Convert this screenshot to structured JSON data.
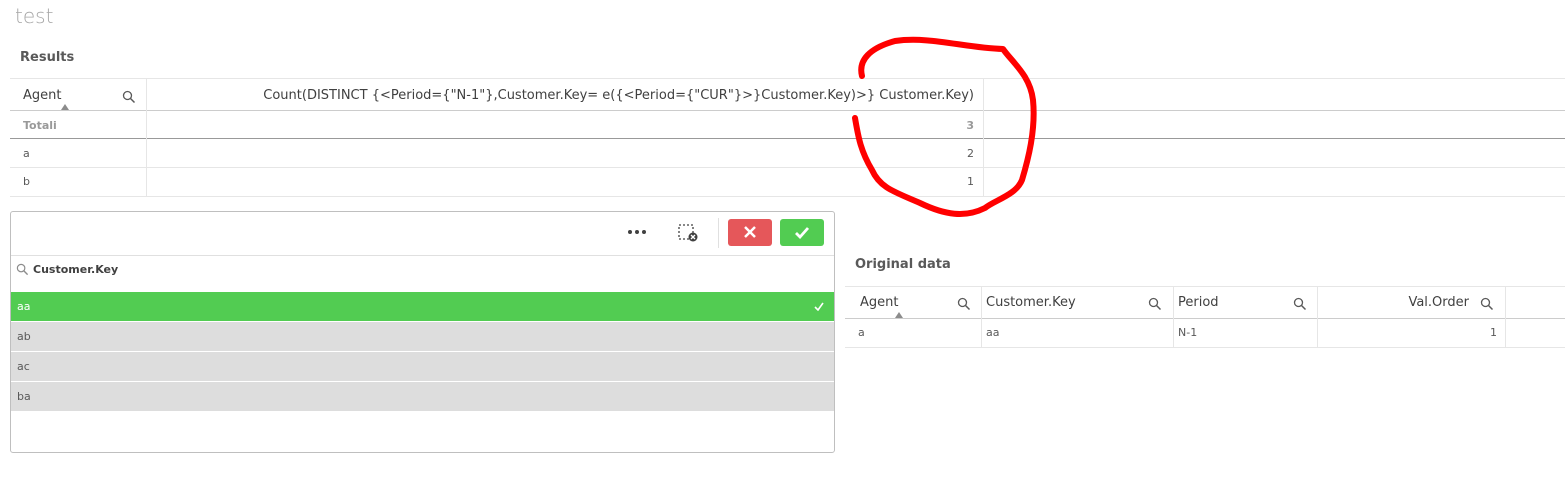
{
  "sheet_title": "test",
  "results": {
    "title": "Results",
    "columns": [
      "Agent",
      "Count(DISTINCT {<Period={\"N-1\"},Customer.Key= e({<Period={\"CUR\"}>}Customer.Key)>} Customer.Key)"
    ],
    "totals_label": "Totali",
    "totals_value": "3",
    "rows": [
      {
        "agent": "a",
        "value": "2"
      },
      {
        "agent": "b",
        "value": "1"
      }
    ]
  },
  "listbox": {
    "field": "Customer.Key",
    "more_icon": "ellipsis-icon",
    "items": [
      {
        "label": "aa",
        "state": "selected"
      },
      {
        "label": "ab",
        "state": "alternative"
      },
      {
        "label": "ac",
        "state": "alternative"
      },
      {
        "label": "ba",
        "state": "alternative"
      }
    ]
  },
  "original": {
    "title": "Original data",
    "columns": [
      "Agent",
      "Customer.Key",
      "Period",
      "Val.Order"
    ],
    "rows": [
      [
        "a",
        "aa",
        "N-1",
        "1"
      ]
    ]
  },
  "colors": {
    "selected": "#52cc52",
    "alternative": "#dddddd",
    "cancel": "#e5575a",
    "annotation": "#ff0000"
  }
}
